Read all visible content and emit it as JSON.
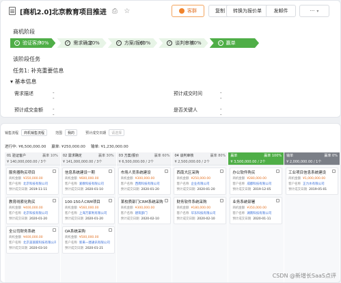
{
  "header": {
    "title": "[商机2.0]北京教育项目推进",
    "buttons": {
      "primary": "客群",
      "copy": "复制",
      "convert": "转换为报价单",
      "send": "发邮件"
    }
  },
  "stage_section": {
    "title": "商机阶段",
    "stages": [
      {
        "label": "验证客户",
        "pct": "30%",
        "state": "done"
      },
      {
        "label": "需求确定",
        "pct": "30%",
        "state": "done"
      },
      {
        "label": "方案/报价",
        "pct": "60%",
        "state": "todo"
      },
      {
        "label": "谈判审核",
        "pct": "80%",
        "state": "todo"
      },
      {
        "label": "赢单",
        "pct": "",
        "state": "done"
      }
    ]
  },
  "task_section": {
    "title": "该阶段任务",
    "task": "任务1:  补充重要信息"
  },
  "basic_info": {
    "title": "基本信息",
    "fields": [
      {
        "label": "需求描述",
        "value": "--"
      },
      {
        "label": "预计成交时间",
        "value": "--"
      },
      {
        "label": "预计成交金额",
        "value": "--"
      },
      {
        "label": "是否关键人",
        "value": "--"
      }
    ]
  },
  "board": {
    "filters": {
      "label1": "销售流程",
      "sel1": "商机销售流程",
      "label2": "范围",
      "sel2": "我的",
      "label3": "预计成交日期",
      "sel3": "请选择"
    },
    "summary": {
      "progress": "进行中: ¥6,500,000.00",
      "win": "赢单: ¥250,000.00",
      "lose": "输单: ¥1,230,000.00"
    },
    "columns": [
      {
        "name": "01  验证客户",
        "pct": "赢率 10%",
        "sum": "¥ 140,000,000.00 / 3个",
        "kind": "normal"
      },
      {
        "name": "02  需求确定",
        "pct": "赢率 30%",
        "sum": "¥ 141,000,000.00 / 3个",
        "kind": "normal"
      },
      {
        "name": "03  方案/报价",
        "pct": "赢率 60%",
        "sum": "¥ 6,500,000.00 / 2个",
        "kind": "normal"
      },
      {
        "name": "04  谈判审核",
        "pct": "赢率 80%",
        "sum": "¥ 2,500,000.00 / 2个",
        "kind": "normal"
      },
      {
        "name": "赢单",
        "pct": "赢率 100%",
        "sum": "¥ 3,500,000.00 / 2个",
        "kind": "win"
      },
      {
        "name": "输单",
        "pct": "赢率 0%",
        "sum": "¥ 2,000,000.00 / 1个",
        "kind": "lose"
      }
    ],
    "cards": [
      [
        {
          "title": "服务器购买项目",
          "amount": "¥350,000.00",
          "customer": "北京科技有限公司",
          "date": "2019-11-11"
        },
        {
          "title": "教育线索化购买",
          "amount": "¥400,000.00",
          "customer": "北京科技有限公司",
          "date": "2020-01-20"
        },
        {
          "title": "全公司财务系统",
          "amount": "¥400,000.00",
          "customer": "北京美丽家科技有限公司",
          "date": "2020-03-10"
        }
      ],
      [
        {
          "title": "信息系统建设一期",
          "amount": "¥600,000.00",
          "customer": "爱教科技有限公司",
          "date": "2020-01-10"
        },
        {
          "title": "100-150人CRM项目",
          "amount": "¥560,000.00",
          "customer": "上海万家利有限公司",
          "date": "2020-01-20"
        },
        {
          "title": "OA系统采购",
          "amount": "¥500,000.00",
          "customer": "新来一建通讯有限公司",
          "date": "2020-01-21"
        }
      ],
      [
        {
          "title": "市场人员系统建设",
          "amount": "¥300,000.00",
          "customer": "西南科技有限公司",
          "date": "2020-01-20"
        },
        {
          "title": "某校质部门CRM系统采购",
          "amount": "¥300,000.00",
          "customer": "建筑部门",
          "date": "2020-02-10"
        }
      ],
      [
        {
          "title": "西南大区采购",
          "amount": "¥250,000.00",
          "customer": "企业有限公司",
          "date": "2020-01-20"
        },
        {
          "title": "财务软件系统采购",
          "amount": "¥180,000.00",
          "customer": "华东科技有限公司",
          "date": "2020-02-10"
        }
      ],
      [
        {
          "title": "办公软件购买",
          "amount": "¥280,000.00",
          "customer": "成都科技有限公司",
          "date": "2019-12-05"
        },
        {
          "title": "业务系统部署",
          "amount": "¥350,000.00",
          "customer": "湖南科技有限公司",
          "date": "2020-01-11"
        }
      ],
      [
        {
          "title": "工业项目信息系统建设",
          "amount": "¥1,000,000.00",
          "customer": "正力水有限公司",
          "date": "2019-05-01"
        }
      ]
    ],
    "card_labels": {
      "amount": "商机金额",
      "customer": "客户名称",
      "date": "预计成交日期"
    }
  },
  "watermark": "CSDN @新增长SaaS点评",
  "colors": {
    "accent": "#4fae47",
    "primary_btn": "#f0832b",
    "lose": "#7b7f87"
  }
}
